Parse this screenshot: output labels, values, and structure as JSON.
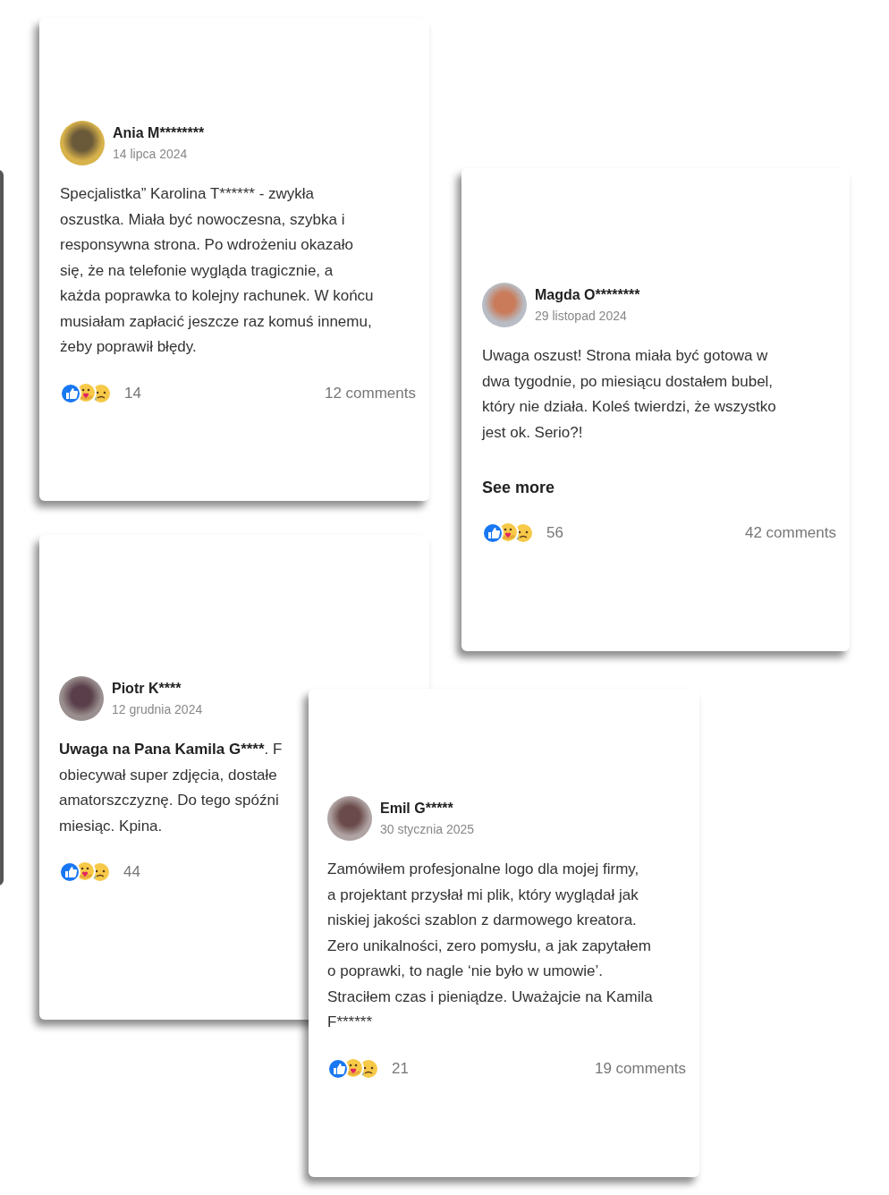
{
  "reviews": [
    {
      "author": "Ania M********",
      "date": "14 lipca 2024",
      "lines": [
        "Specjalistka” Karolina T****** - zwykła",
        "oszustka. Miała być nowoczesna, szybka i",
        "responsywna strona. Po wdrożeniu okazało",
        "się, że na telefonie wygląda tragicznie, a",
        "każda poprawka to kolejny rachunek. W końcu",
        "musiałam zapłacić jeszcze raz komuś innemu,",
        "żeby poprawił błędy."
      ],
      "reactions": "14",
      "comments": "12 comments"
    },
    {
      "author": "Magda O********",
      "date": "29 listopad 2024",
      "lines": [
        "Uwaga oszust! Strona miała być gotowa w",
        "dwa tygodnie, po miesiącu dostałem bubel,",
        "który nie działa. Koleś twierdzi, że wszystko",
        "jest ok. Serio?!"
      ],
      "see_more": "See more",
      "reactions": "56",
      "comments": "42 comments"
    },
    {
      "author": "Piotr K****",
      "date": "12 grudnia 2024",
      "lead": "Uwaga na Pana Kamila G****",
      "lines": [
        ". F",
        "obiecywał super zdjęcia, dostałe",
        "amatorszczyznę. Do tego spóźni",
        "miesiąc. Kpina."
      ],
      "reactions": "44"
    },
    {
      "author": "Emil G*****",
      "date": "30 stycznia 2025",
      "lines": [
        "Zamówiłem profesjonalne logo dla mojej firmy,",
        "a projektant przysłał mi plik, który wyglądał jak",
        "niskiej jakości szablon z darmowego kreatora.",
        "Zero unikalności, zero pomysłu, a jak zapytałem",
        "o poprawki, to nagle ‘nie było w umowie’.",
        "Straciłem czas i pieniądze. Uważajcie na Kamila",
        "F******"
      ],
      "reactions": "21",
      "comments": "19 comments"
    }
  ]
}
